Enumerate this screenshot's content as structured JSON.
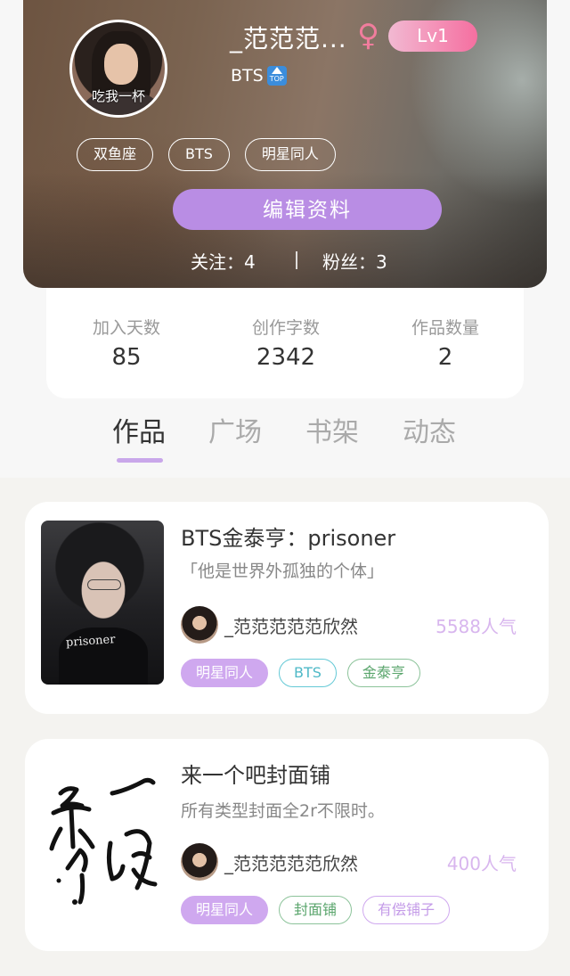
{
  "profile": {
    "username": "_范范范...",
    "gender_icon": "female-icon",
    "level": "Lv1",
    "signature": "BTS",
    "signature_icon": "top-arrow-icon",
    "signature_icon_text": "TOP",
    "avatar_caption": "吃我一杯",
    "tags": [
      "双鱼座",
      "BTS",
      "明星同人"
    ],
    "edit_button": "编辑资料",
    "following_label": "关注：",
    "following_count": "4",
    "fans_label": "粉丝：",
    "fans_count": "3"
  },
  "stats": [
    {
      "label": "加入天数",
      "value": "85"
    },
    {
      "label": "创作字数",
      "value": "2342"
    },
    {
      "label": "作品数量",
      "value": "2"
    }
  ],
  "tabs": [
    "作品",
    "广场",
    "书架",
    "动态"
  ],
  "active_tab": "作品",
  "works": [
    {
      "title": "BTS金泰亨：prisoner",
      "description": "「他是世界外孤独的个体」",
      "author": "_范范范范范欣然",
      "popularity": "5588人气",
      "cover_text": "prisoner",
      "tags": [
        "明星同人",
        "BTS",
        "金泰亨"
      ]
    },
    {
      "title": "来一个吧封面铺",
      "description": "所有类型封面全2r不限时。",
      "author": "_范范范范范欣然",
      "popularity": "400人气",
      "tags": [
        "明星同人",
        "封面铺",
        "有偿铺子"
      ]
    }
  ],
  "colors": {
    "accent": "#b98de4",
    "level_badge": "#f56fa0",
    "gender": "#f07d9d",
    "tab_indicator": "#c9a7ea",
    "popularity": "#d8b6ee"
  }
}
